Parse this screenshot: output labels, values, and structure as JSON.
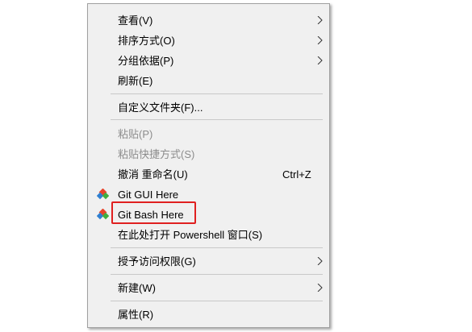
{
  "menu": {
    "items": [
      {
        "label": "查看(V)",
        "submenu": true,
        "disabled": false
      },
      {
        "label": "排序方式(O)",
        "submenu": true,
        "disabled": false
      },
      {
        "label": "分组依据(P)",
        "submenu": true,
        "disabled": false
      },
      {
        "label": "刷新(E)",
        "submenu": false,
        "disabled": false
      },
      {
        "label": "自定义文件夹(F)...",
        "submenu": false,
        "disabled": false
      },
      {
        "label": "粘贴(P)",
        "submenu": false,
        "disabled": true
      },
      {
        "label": "粘贴快捷方式(S)",
        "submenu": false,
        "disabled": true
      },
      {
        "label": "撤消 重命名(U)",
        "shortcut": "Ctrl+Z",
        "submenu": false,
        "disabled": false
      },
      {
        "label": "Git GUI Here",
        "icon": "git-icon",
        "submenu": false,
        "disabled": false
      },
      {
        "label": "Git Bash Here",
        "icon": "git-icon",
        "submenu": false,
        "disabled": false
      },
      {
        "label": "在此处打开 Powershell 窗口(S)",
        "submenu": false,
        "disabled": false
      },
      {
        "label": "授予访问权限(G)",
        "submenu": true,
        "disabled": false
      },
      {
        "label": "新建(W)",
        "submenu": true,
        "disabled": false
      },
      {
        "label": "属性(R)",
        "submenu": false,
        "disabled": false
      }
    ]
  },
  "colors": {
    "menu_background": "#f0f0f0",
    "disabled_text": "#8c8c8c",
    "highlight_border": "#e02020",
    "git_icon_red": "#e8442c",
    "git_icon_blue": "#2f7fd0",
    "git_icon_green": "#3fae3f"
  }
}
